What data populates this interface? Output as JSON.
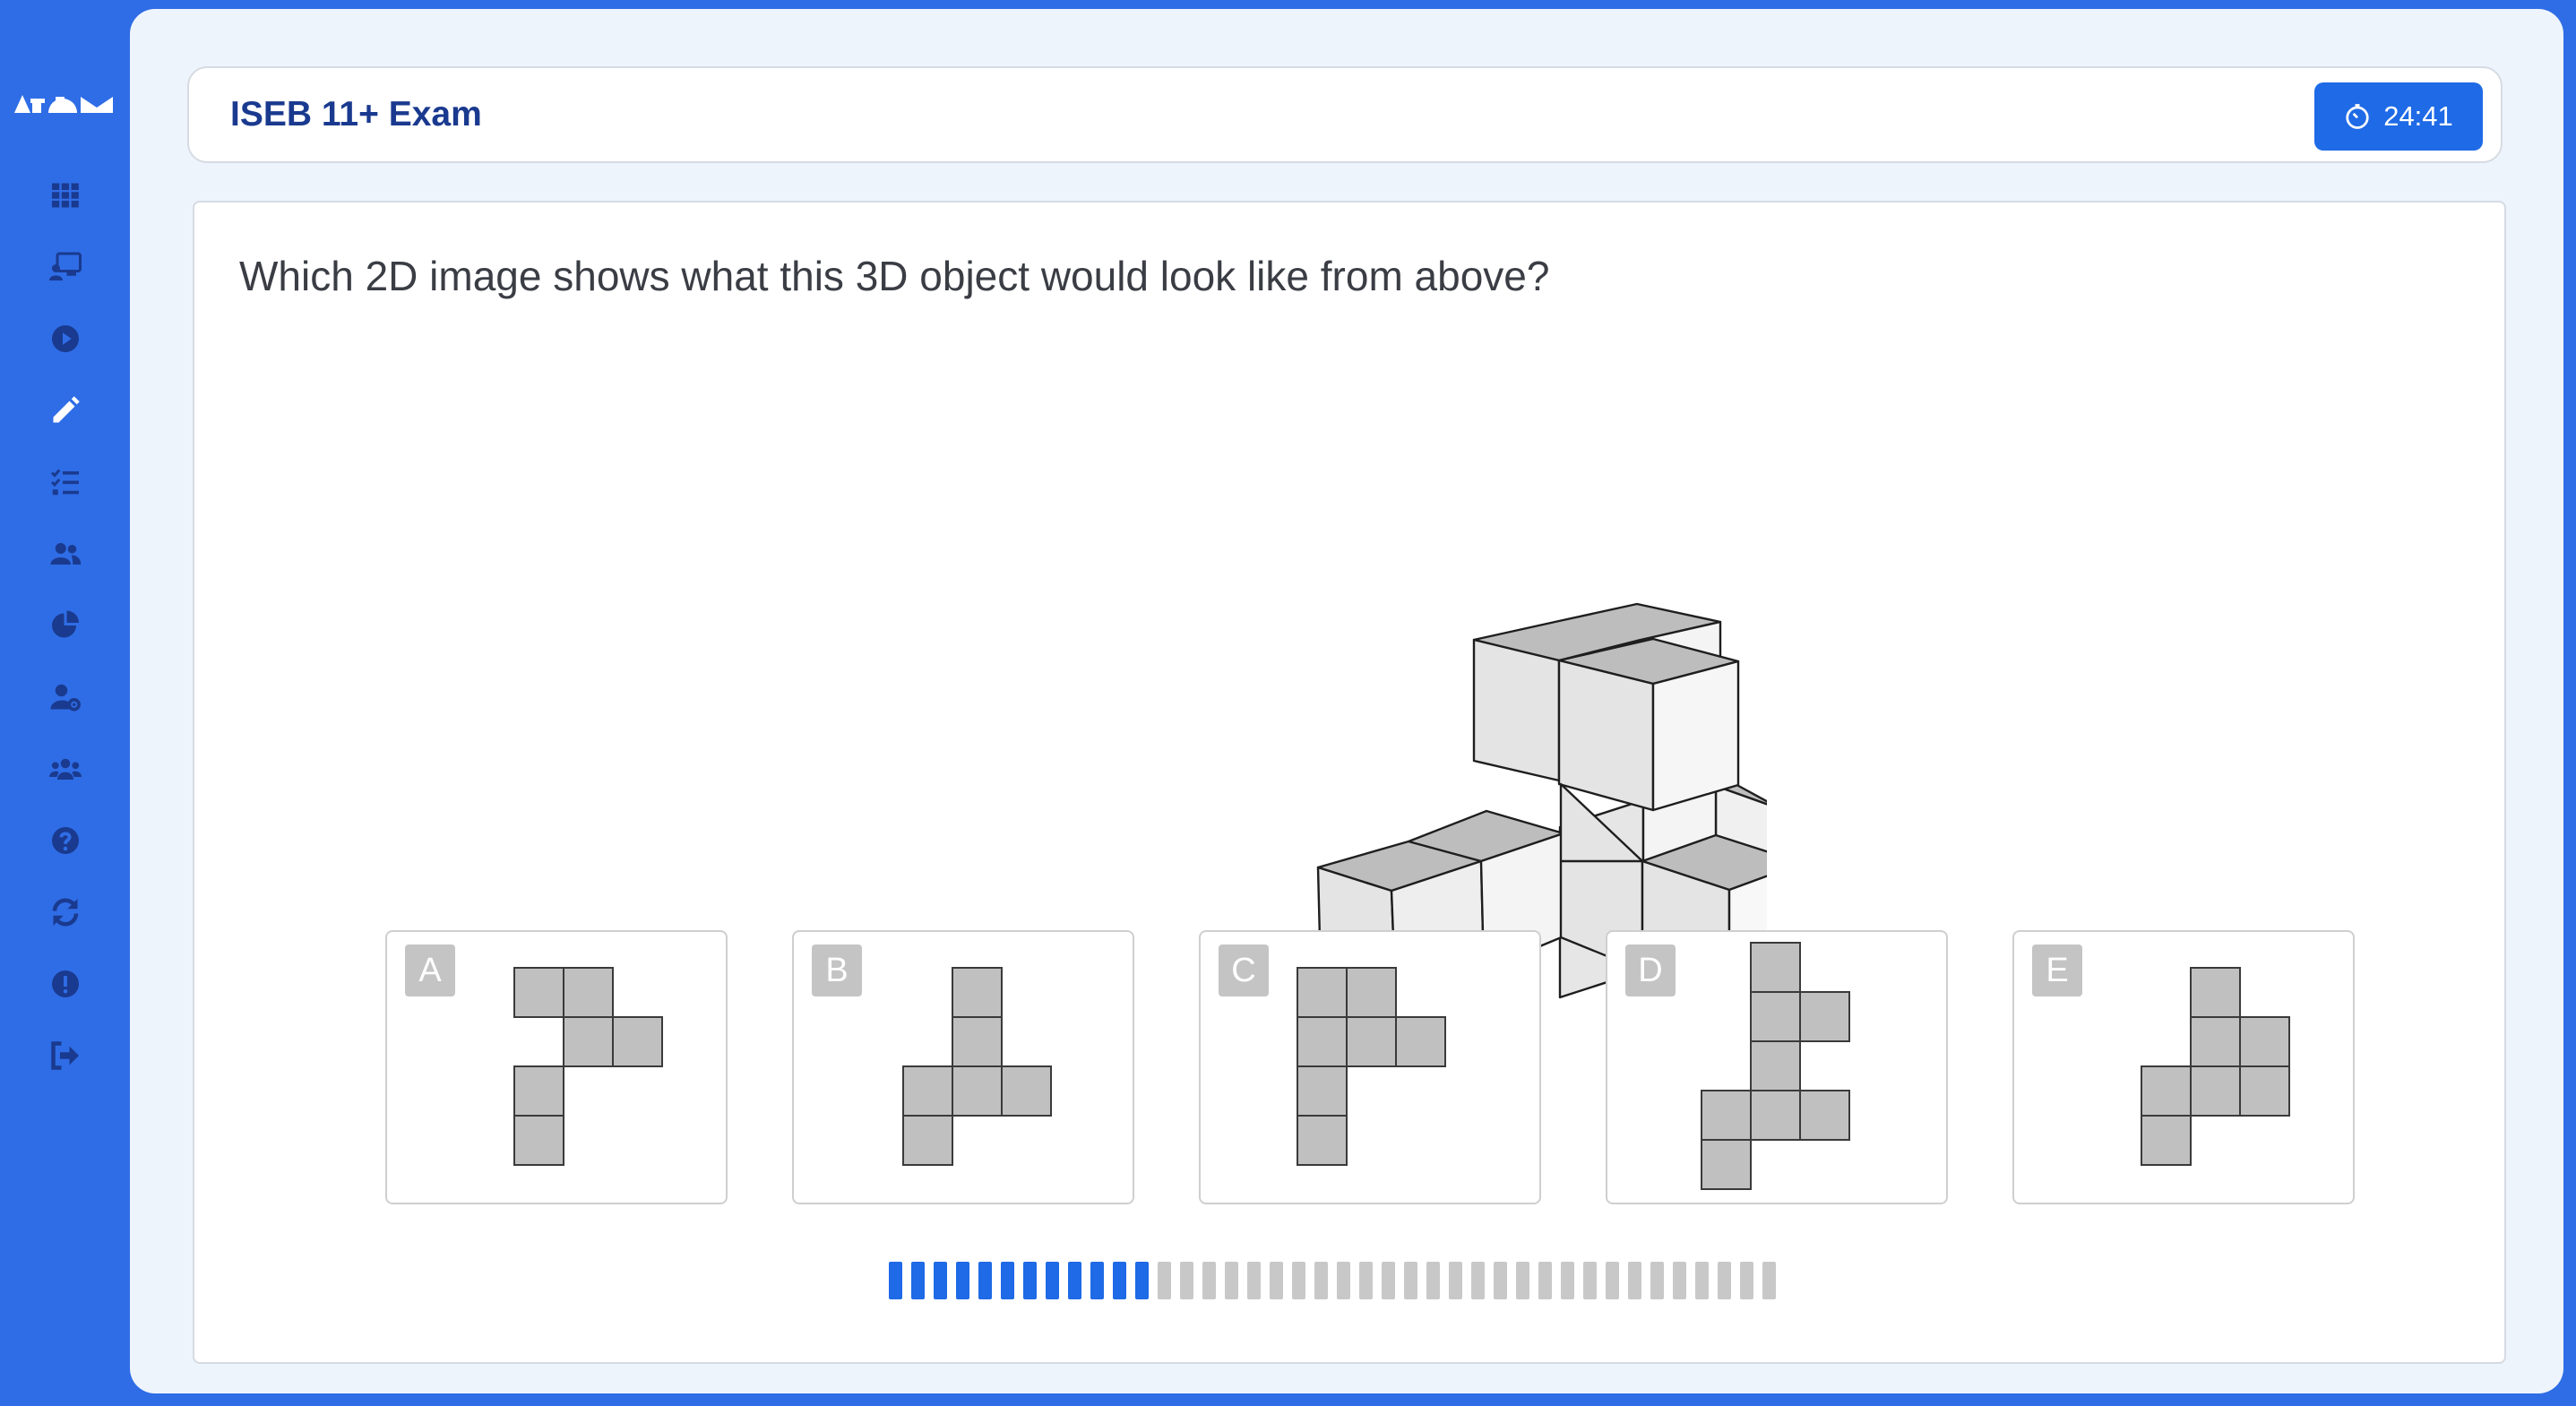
{
  "app": {
    "logo_text": "atom"
  },
  "sidebar": {
    "items": [
      {
        "icon": "grid-icon",
        "label": "dashboard"
      },
      {
        "icon": "teach-icon",
        "label": "lessons"
      },
      {
        "icon": "play-icon",
        "label": "videos"
      },
      {
        "icon": "pencil-icon",
        "label": "practice"
      },
      {
        "icon": "checklist-icon",
        "label": "tasks"
      },
      {
        "icon": "users-icon",
        "label": "classes"
      },
      {
        "icon": "pie-chart-icon",
        "label": "reports"
      },
      {
        "icon": "user-settings-icon",
        "label": "account"
      },
      {
        "icon": "group-icon",
        "label": "groups"
      },
      {
        "icon": "help-icon",
        "label": "help"
      },
      {
        "icon": "refresh-icon",
        "label": "sync"
      },
      {
        "icon": "alert-icon",
        "label": "report-issue"
      },
      {
        "icon": "logout-icon",
        "label": "logout"
      }
    ]
  },
  "header": {
    "title": "ISEB 11+ Exam",
    "timer": "24:41",
    "timer_icon": "stopwatch-icon"
  },
  "question": {
    "text": "Which 2D image shows what this 3D object would look like from above?",
    "options": [
      {
        "letter": "A",
        "cells": [
          [
            0,
            0
          ],
          [
            1,
            0
          ],
          [
            1,
            1
          ],
          [
            2,
            1
          ],
          [
            0,
            2
          ],
          [
            0,
            3
          ]
        ]
      },
      {
        "letter": "B",
        "cells": [
          [
            1,
            0
          ],
          [
            1,
            1
          ],
          [
            0,
            2
          ],
          [
            1,
            2
          ],
          [
            2,
            2
          ],
          [
            0,
            3
          ]
        ]
      },
      {
        "letter": "C",
        "cells": [
          [
            0,
            0
          ],
          [
            1,
            0
          ],
          [
            0,
            1
          ],
          [
            1,
            1
          ],
          [
            2,
            1
          ],
          [
            0,
            2
          ],
          [
            0,
            3
          ]
        ]
      },
      {
        "letter": "D",
        "cells": [
          [
            1,
            0
          ],
          [
            1,
            1
          ],
          [
            2,
            1
          ],
          [
            1,
            2
          ],
          [
            0,
            3
          ],
          [
            1,
            3
          ],
          [
            2,
            3
          ],
          [
            0,
            4
          ]
        ]
      },
      {
        "letter": "E",
        "cells": [
          [
            1,
            0
          ],
          [
            1,
            1
          ],
          [
            2,
            1
          ],
          [
            0,
            2
          ],
          [
            1,
            2
          ],
          [
            2,
            2
          ],
          [
            0,
            3
          ]
        ]
      }
    ]
  },
  "progress": {
    "completed": 12,
    "total": 40
  },
  "colors": {
    "accent": "#1f6ae6",
    "sidebar": "#2f6de6",
    "title": "#1a3a8f",
    "cell_fill": "#c0c0c0",
    "progress_empty": "#c8c8c8"
  }
}
